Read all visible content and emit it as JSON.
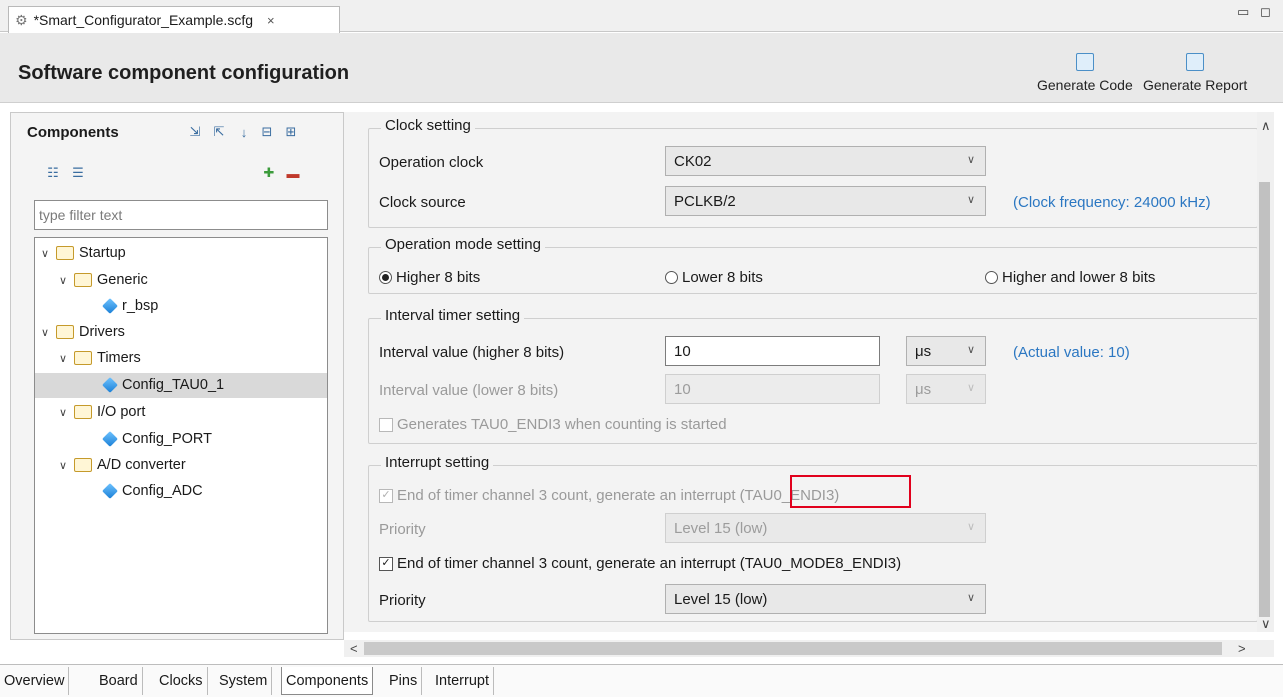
{
  "editor_tab": {
    "title": "*Smart_Configurator_Example.scfg",
    "close": "×"
  },
  "window_controls": {
    "minimize": "▭",
    "maximize": "◻"
  },
  "header": {
    "title": "Software component configuration",
    "generate_code": "Generate Code",
    "generate_report": "Generate Report"
  },
  "components": {
    "title": "Components",
    "filter_placeholder": "type filter text",
    "tree": [
      {
        "label": "Startup",
        "type": "folder",
        "level": 0
      },
      {
        "label": "Generic",
        "type": "folder",
        "level": 1
      },
      {
        "label": "r_bsp",
        "type": "component",
        "level": 2
      },
      {
        "label": "Drivers",
        "type": "folder",
        "level": 0
      },
      {
        "label": "Timers",
        "type": "folder",
        "level": 1
      },
      {
        "label": "Config_TAU0_1",
        "type": "component",
        "level": 2,
        "selected": true
      },
      {
        "label": "I/O port",
        "type": "folder",
        "level": 1
      },
      {
        "label": "Config_PORT",
        "type": "component",
        "level": 2
      },
      {
        "label": "A/D converter",
        "type": "folder",
        "level": 1
      },
      {
        "label": "Config_ADC",
        "type": "component",
        "level": 2
      }
    ]
  },
  "clock": {
    "title": "Clock setting",
    "op_clock_label": "Operation clock",
    "op_clock_value": "CK02",
    "source_label": "Clock source",
    "source_value": "PCLKB/2",
    "freq_note": "(Clock frequency: 24000 kHz)"
  },
  "mode": {
    "title": "Operation mode setting",
    "higher": "Higher 8 bits",
    "lower": "Lower 8 bits",
    "both": "Higher and lower 8 bits",
    "selected": "higher"
  },
  "interval": {
    "title": "Interval timer setting",
    "high_label": "Interval value (higher 8 bits)",
    "high_value": "10",
    "high_unit": "μs",
    "actual_note": "(Actual value: 10)",
    "low_label": "Interval value (lower 8 bits)",
    "low_value": "10",
    "low_unit": "μs",
    "gen_check": "Generates TAU0_ENDI3 when counting is started"
  },
  "interrupt": {
    "title": "Interrupt setting",
    "chk1_prefix": "End of timer channel 3 count, generate an interrupt",
    "chk1_tag": "(TAU0_ENDI3)",
    "priority1_label": "Priority",
    "priority1_value": "Level 15 (low)",
    "chk2": "End of timer channel 3 count, generate an interrupt (TAU0_MODE8_ENDI3)",
    "priority2_label": "Priority",
    "priority2_value": "Level 15 (low)"
  },
  "bottom_tabs": [
    "Overview",
    "Board",
    "Clocks",
    "System",
    "Components",
    "Pins",
    "Interrupt"
  ],
  "active_bottom_tab": "Components",
  "colors": {
    "highlight_box": "#e1001d",
    "note_text": "#2b77c2",
    "selection": "#d9d9d9"
  }
}
